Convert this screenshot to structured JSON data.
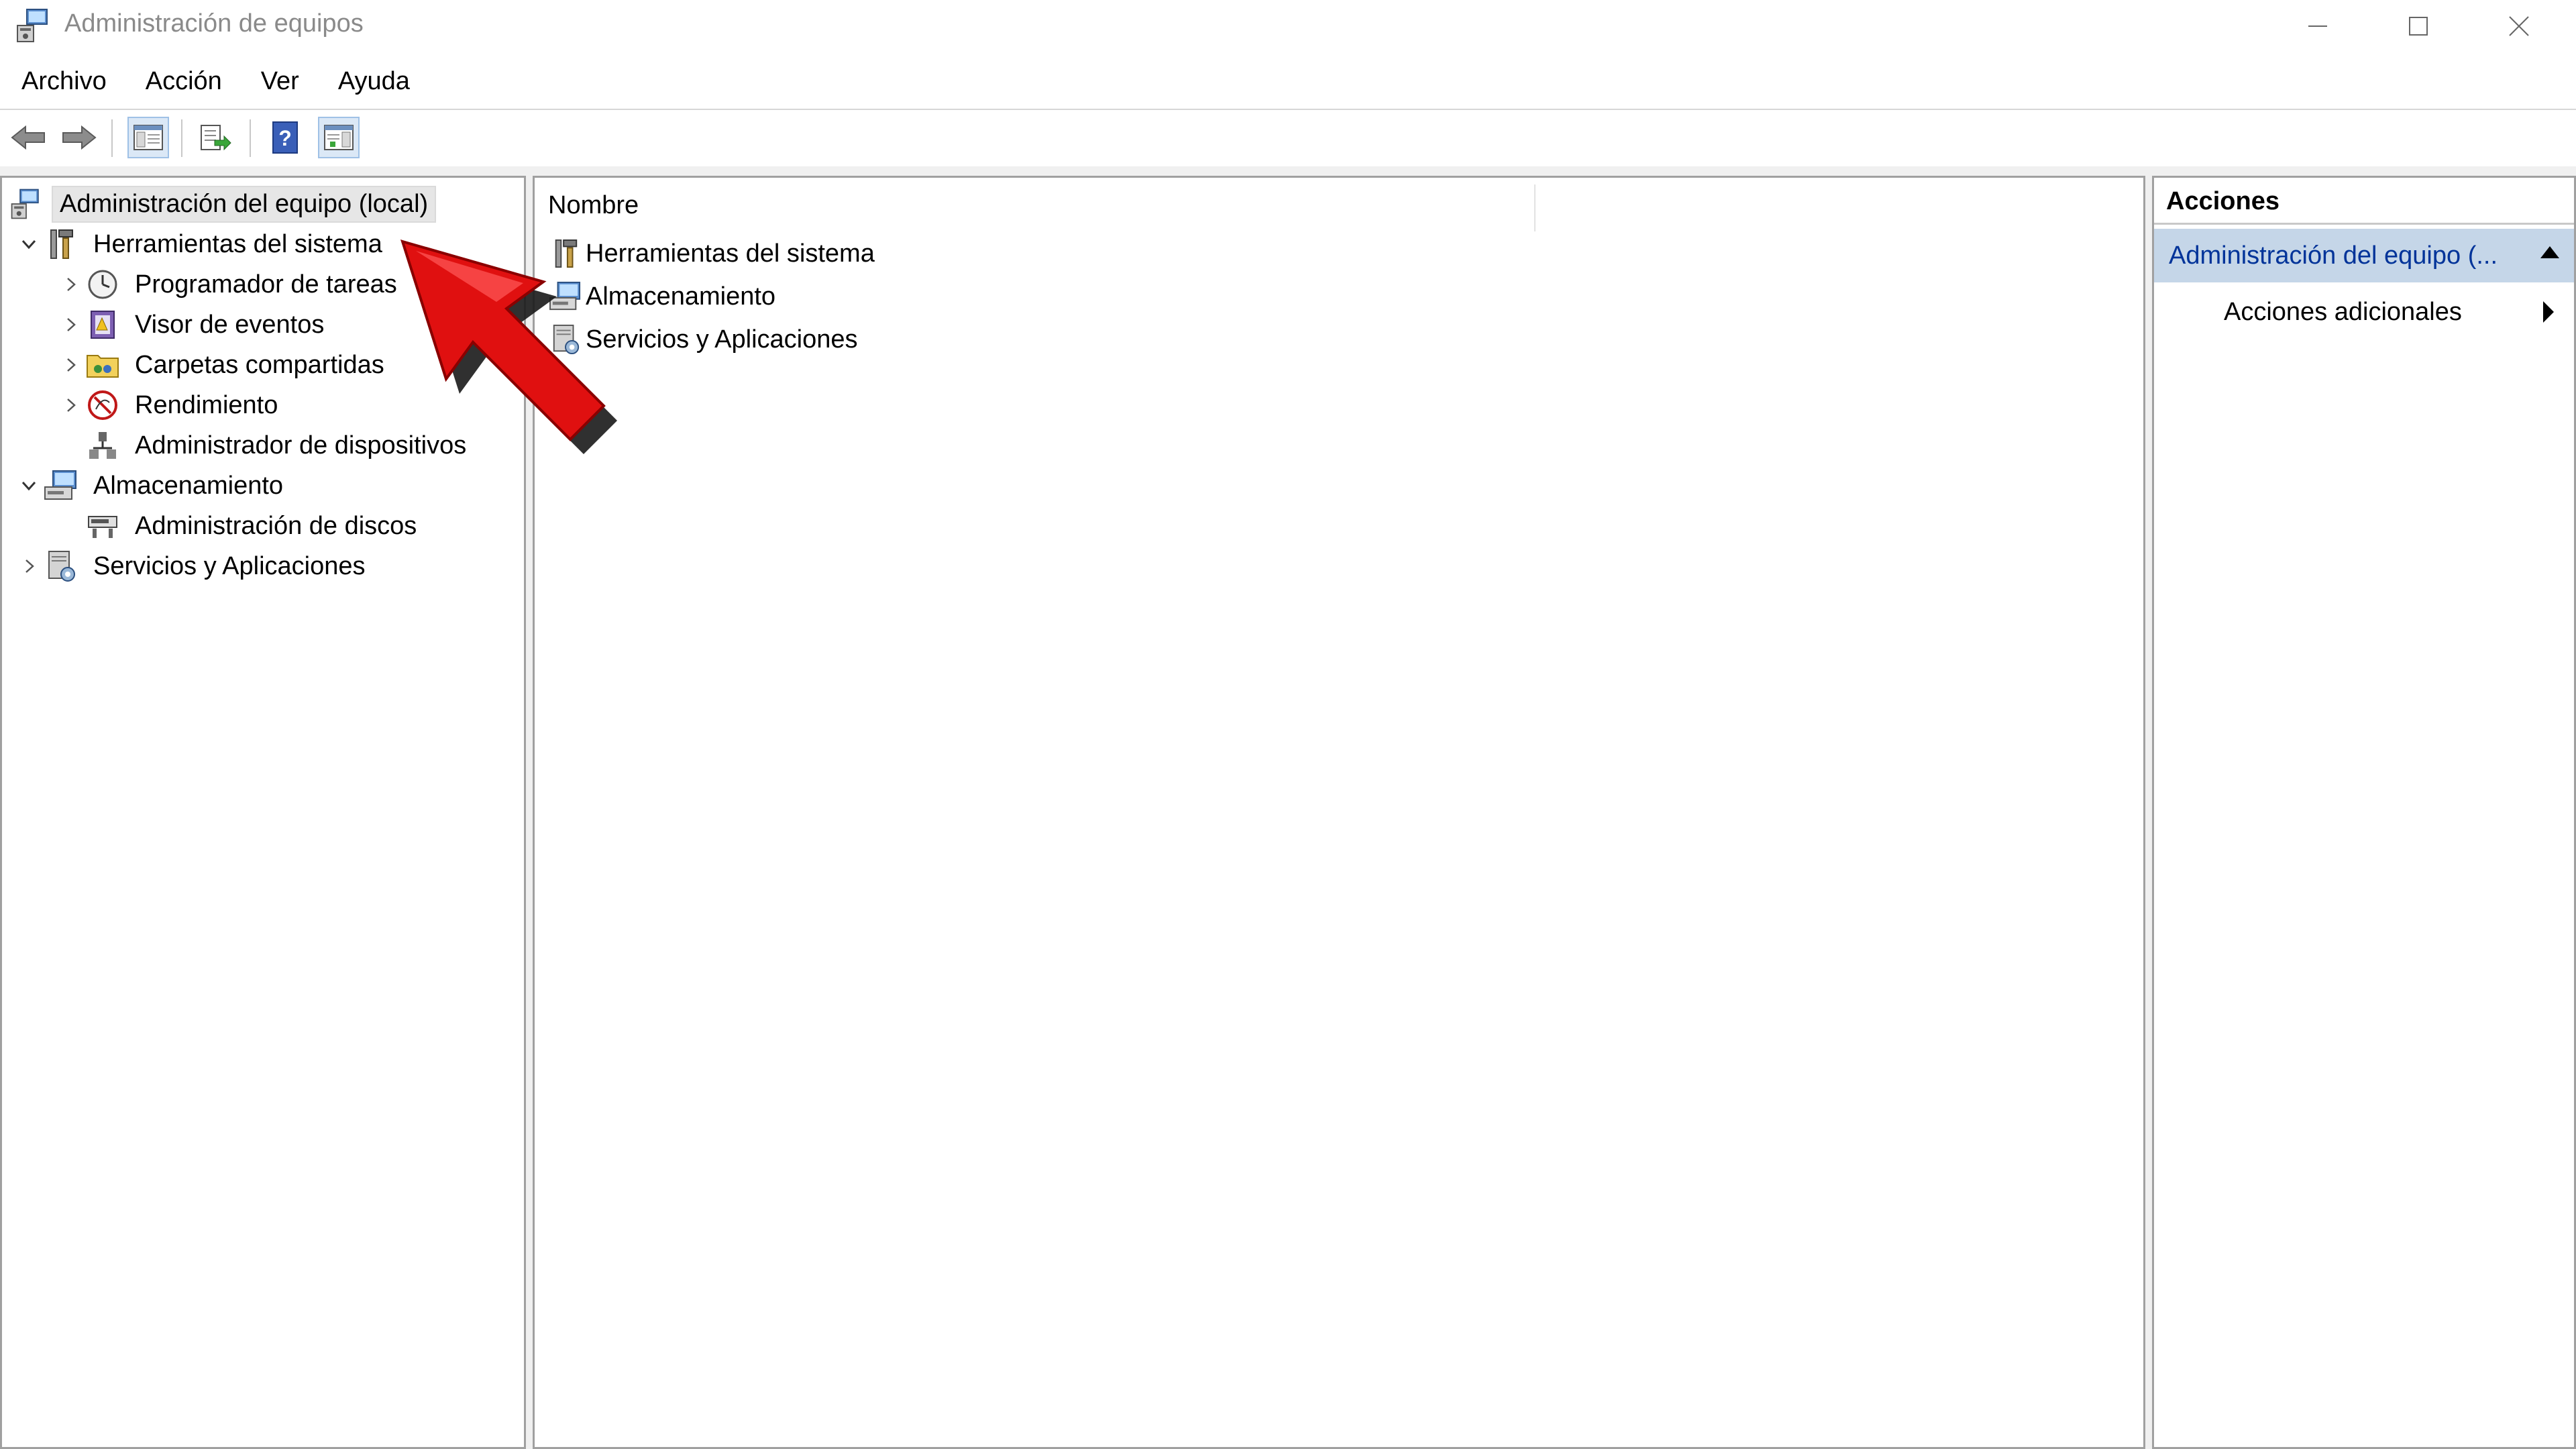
{
  "window": {
    "title": "Administración de equipos",
    "icons": {
      "app": "computer-management-icon",
      "minimize": "minimize-icon",
      "maximize": "maximize-icon",
      "close": "close-icon"
    }
  },
  "menu": {
    "items": [
      "Archivo",
      "Acción",
      "Ver",
      "Ayuda"
    ]
  },
  "toolbar": {
    "buttons": [
      "back-arrow-icon",
      "forward-arrow-icon",
      "show-hide-tree-icon",
      "export-list-icon",
      "help-icon",
      "show-hide-action-pane-icon"
    ]
  },
  "tree": {
    "root": "Administración del equipo (local)",
    "items": [
      {
        "label": "Herramientas del sistema",
        "icon": "tools-icon",
        "expanded": true
      },
      {
        "label": "Programador de tareas",
        "icon": "clock-icon"
      },
      {
        "label": "Visor de eventos",
        "icon": "event-viewer-icon"
      },
      {
        "label": "Carpetas compartidas",
        "icon": "shared-folder-icon"
      },
      {
        "label": "Rendimiento",
        "icon": "performance-icon"
      },
      {
        "label": "Administrador de dispositivos",
        "icon": "device-manager-icon"
      },
      {
        "label": "Almacenamiento",
        "icon": "storage-icon",
        "expanded": true
      },
      {
        "label": "Administración de discos",
        "icon": "disk-icon"
      },
      {
        "label": "Servicios y Aplicaciones",
        "icon": "services-icon",
        "expanded": false
      }
    ]
  },
  "list": {
    "column_header": "Nombre",
    "rows": [
      "Herramientas del sistema",
      "Almacenamiento",
      "Servicios y Aplicaciones"
    ]
  },
  "actions": {
    "title": "Acciones",
    "section": "Administración del equipo (...",
    "item": "Acciones adicionales"
  },
  "colors": {
    "annotation_arrow": "#e01010",
    "action_section_bg": "#c5d6e8",
    "title_text": "#8a8a8a"
  }
}
